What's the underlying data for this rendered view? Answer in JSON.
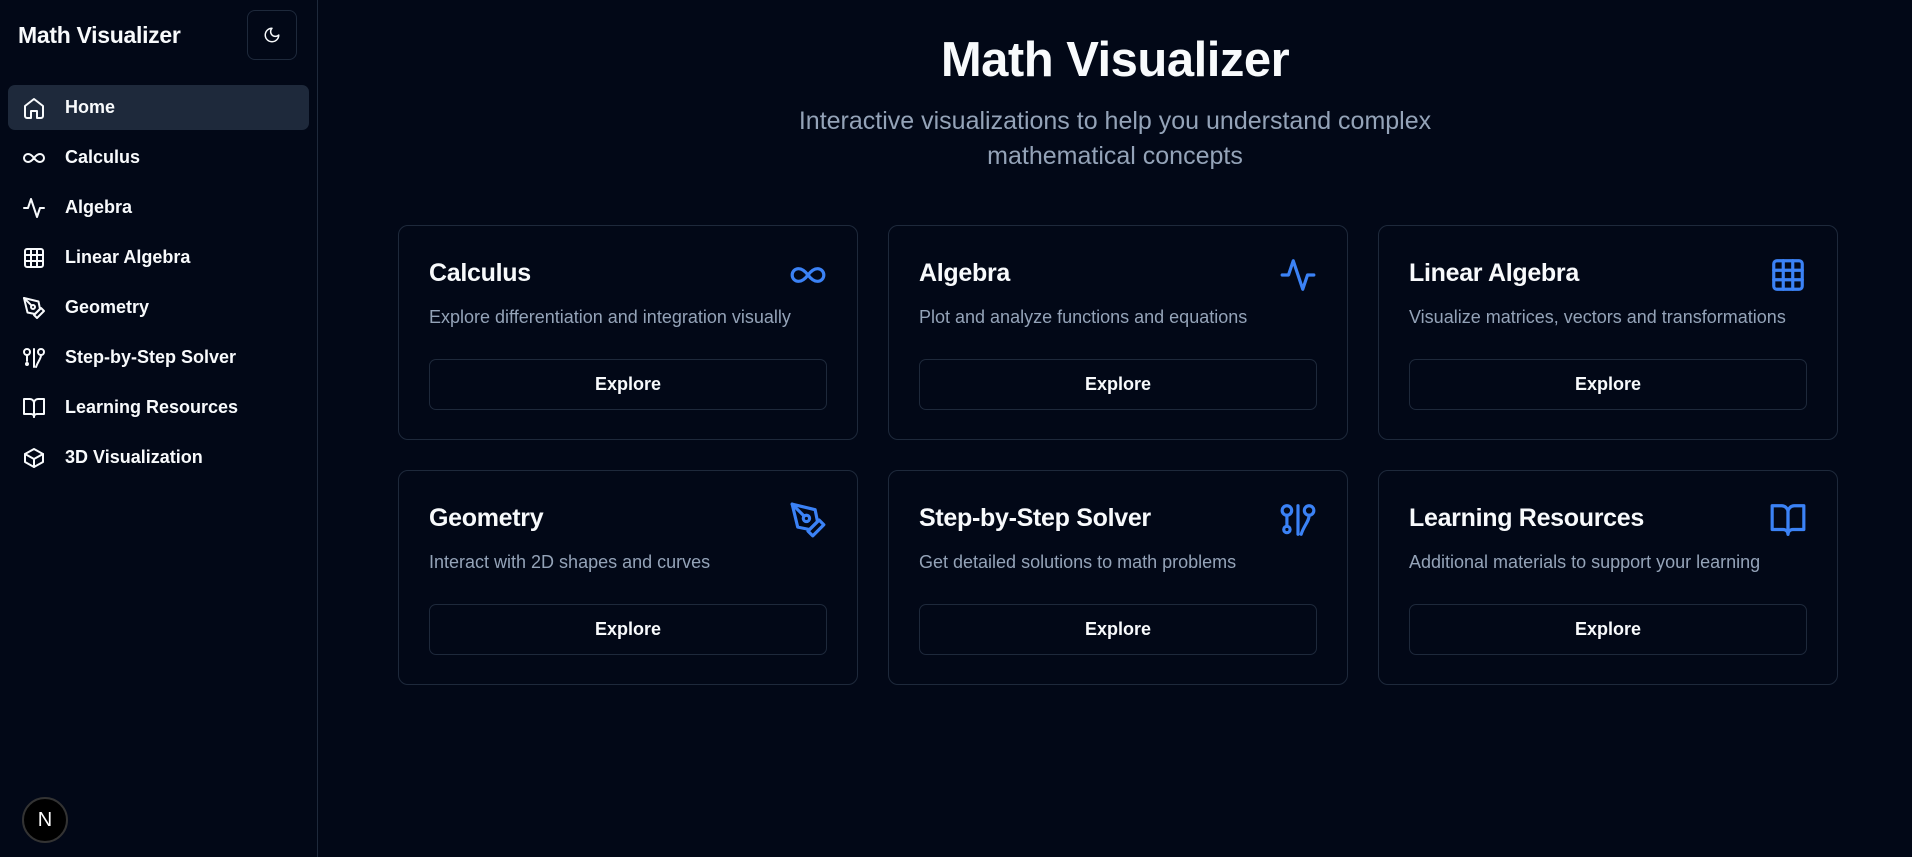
{
  "sidebar": {
    "title": "Math Visualizer",
    "theme_toggle_icon": "moon-icon",
    "items": [
      {
        "label": "Home",
        "icon": "home-icon",
        "active": true
      },
      {
        "label": "Calculus",
        "icon": "infinity-icon"
      },
      {
        "label": "Algebra",
        "icon": "activity-icon"
      },
      {
        "label": "Linear Algebra",
        "icon": "grid-icon"
      },
      {
        "label": "Geometry",
        "icon": "pen-tool-icon"
      },
      {
        "label": "Step-by-Step Solver",
        "icon": "git-pull-request-icon"
      },
      {
        "label": "Learning Resources",
        "icon": "book-open-icon"
      },
      {
        "label": "3D Visualization",
        "icon": "box-icon"
      }
    ],
    "badge": "N"
  },
  "main": {
    "title": "Math Visualizer",
    "subtitle": "Interactive visualizations to help you understand complex mathematical concepts",
    "cards": [
      {
        "title": "Calculus",
        "description": "Explore differentiation and integration visually",
        "button": "Explore",
        "icon": "infinity-icon"
      },
      {
        "title": "Algebra",
        "description": "Plot and analyze functions and equations",
        "button": "Explore",
        "icon": "activity-icon"
      },
      {
        "title": "Linear Algebra",
        "description": "Visualize matrices, vectors and transformations",
        "button": "Explore",
        "icon": "grid-icon"
      },
      {
        "title": "Geometry",
        "description": "Interact with 2D shapes and curves",
        "button": "Explore",
        "icon": "pen-tool-icon"
      },
      {
        "title": "Step-by-Step Solver",
        "description": "Get detailed solutions to math problems",
        "button": "Explore",
        "icon": "git-pull-request-icon"
      },
      {
        "title": "Learning Resources",
        "description": "Additional materials to support your learning",
        "button": "Explore",
        "icon": "book-open-icon"
      }
    ]
  },
  "colors": {
    "background": "#020817",
    "border": "#1e293b",
    "muted_text": "#94a3b8",
    "accent": "#3b82f6",
    "active_nav": "#1e293b"
  }
}
